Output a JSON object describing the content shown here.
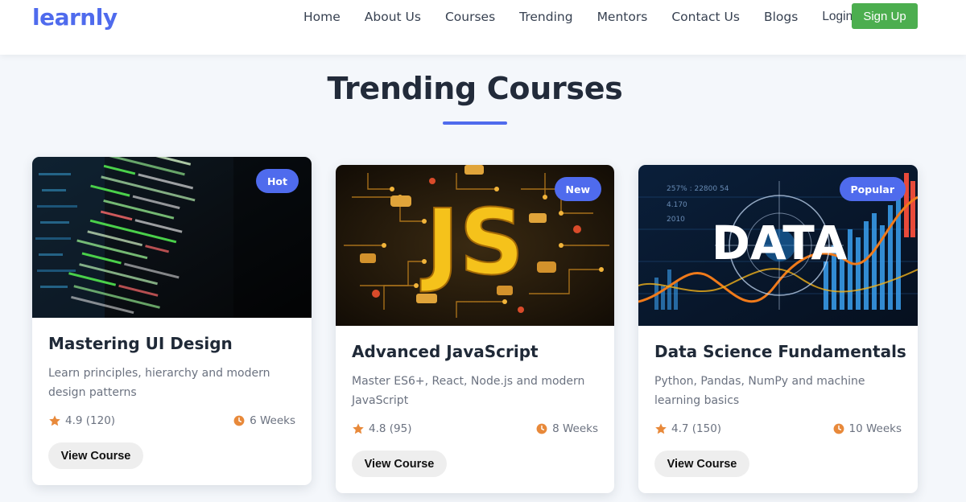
{
  "brand": {
    "logo_text": "learnly",
    "accent": "#4f6bed",
    "signup_color": "#4cae4f"
  },
  "nav": {
    "links": [
      "Home",
      "About Us",
      "Courses",
      "Trending",
      "Mentors",
      "Contact Us",
      "Blogs"
    ],
    "login": "Login",
    "signup": "Sign Up"
  },
  "section": {
    "title": "Trending Courses"
  },
  "courses": [
    {
      "badge": "Hot",
      "image_label": "",
      "title": "Mastering UI Design",
      "description": "Learn principles, hierarchy and modern design patterns",
      "rating": "4.9 (120)",
      "duration": "6 Weeks",
      "button": "View Course"
    },
    {
      "badge": "New",
      "image_label": "JS",
      "title": "Advanced JavaScript",
      "description": "Master ES6+, React, Node.js and modern JavaScript",
      "rating": "4.8 (95)",
      "duration": "8 Weeks",
      "button": "View Course"
    },
    {
      "badge": "Popular",
      "image_label": "DATA",
      "title": "Data Science Fundamentals",
      "description": "Python, Pandas, NumPy and machine learning basics",
      "rating": "4.7 (150)",
      "duration": "10 Weeks",
      "button": "View Course"
    }
  ],
  "icons": {
    "rating": "star-icon",
    "duration": "clock-icon"
  }
}
